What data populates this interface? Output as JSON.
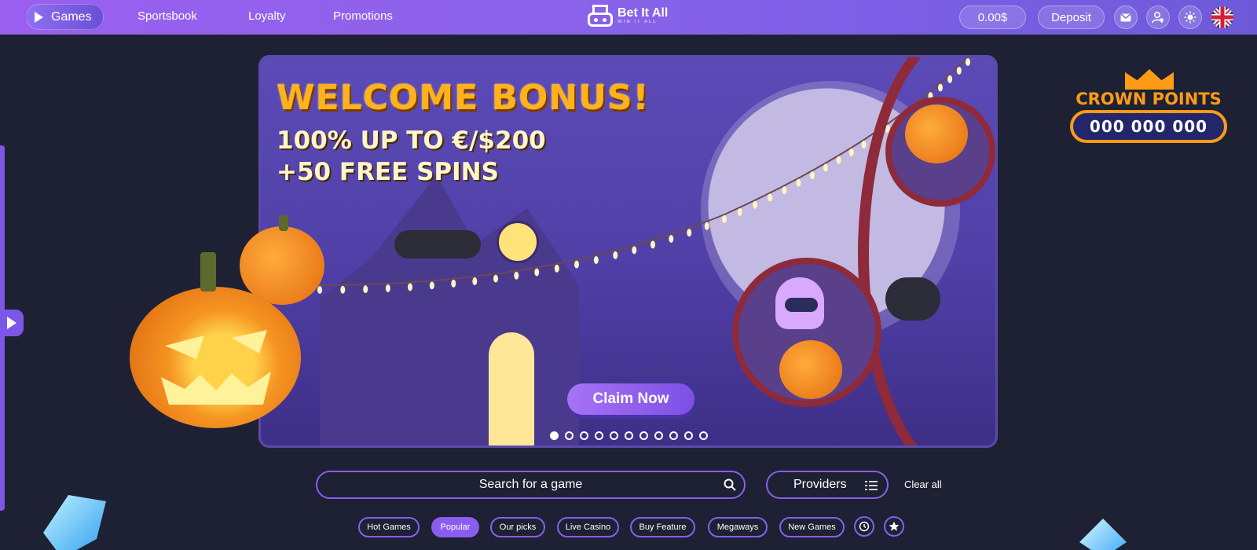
{
  "nav": {
    "games": "Games",
    "sportsbook": "Sportsbook",
    "loyalty": "Loyalty",
    "promotions": "Promotions"
  },
  "logo": {
    "title": "Bet It All",
    "subtitle": "WIN IT ALL"
  },
  "header": {
    "balance": "0.00$",
    "deposit": "Deposit",
    "icons": [
      "mail-icon",
      "user-settings-icon",
      "sun-icon",
      "uk-flag-icon"
    ]
  },
  "banner": {
    "headline": "WELCOME BONUS!",
    "line1": "100% UP TO €/$200",
    "line2": "+50 FREE SPINS",
    "cta": "Claim Now",
    "slide_count": 11,
    "active_slide": 1
  },
  "crown": {
    "title": "CROWN POINTS",
    "value": "000 000 000"
  },
  "search": {
    "placeholder": "Search for a game"
  },
  "filters": {
    "providers": "Providers",
    "clear_all": "Clear all"
  },
  "categories": [
    {
      "label": "Hot Games",
      "active": false
    },
    {
      "label": "Popular",
      "active": true
    },
    {
      "label": "Our picks",
      "active": false
    },
    {
      "label": "Live Casino",
      "active": false
    },
    {
      "label": "Buy Feature",
      "active": false
    },
    {
      "label": "Megaways",
      "active": false
    },
    {
      "label": "New Games",
      "active": false
    }
  ],
  "colors": {
    "accent": "#8a5df0",
    "topbar": "#8a63ea",
    "background": "#1d2133",
    "crown": "#ff9b15"
  }
}
